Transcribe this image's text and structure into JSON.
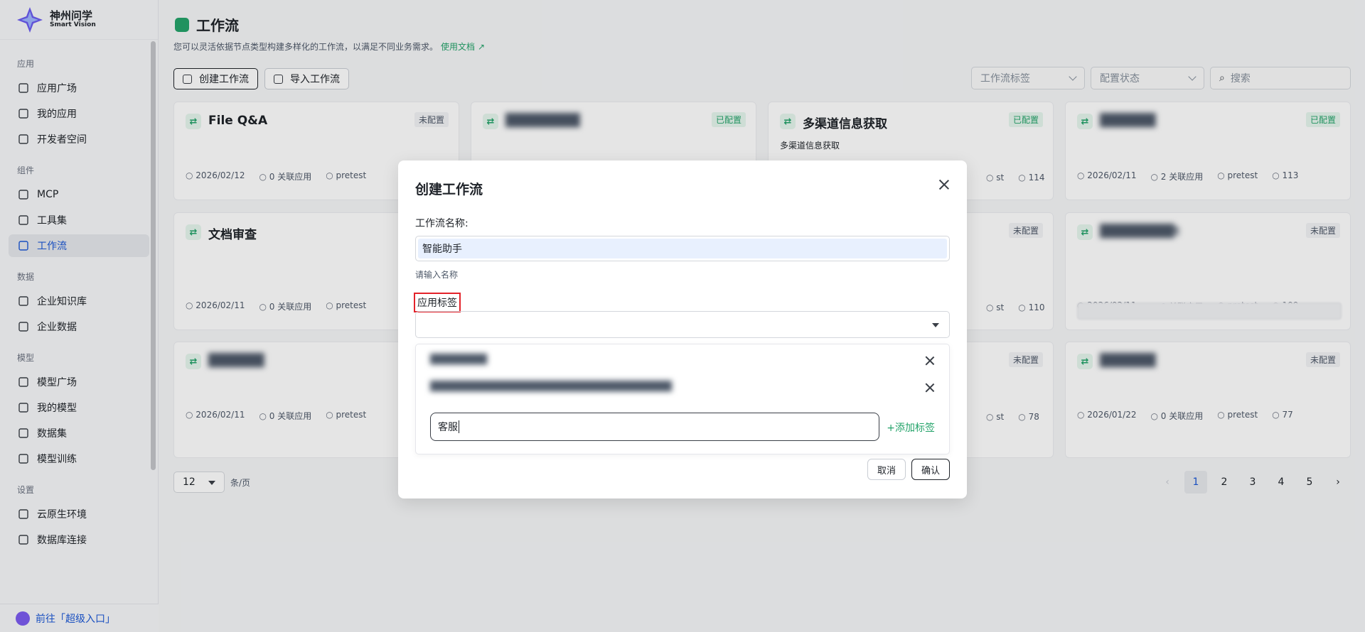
{
  "brand": {
    "name_cn": "神州问学",
    "name_en": "Smart Vision"
  },
  "sidebar": {
    "groups": [
      {
        "label": "应用",
        "items": [
          {
            "label": "应用广场",
            "icon": "store-icon"
          },
          {
            "label": "我的应用",
            "icon": "grid-icon"
          },
          {
            "label": "开发者空间",
            "icon": "cube-icon"
          }
        ]
      },
      {
        "label": "组件",
        "items": [
          {
            "label": "MCP",
            "icon": "mcp-icon"
          },
          {
            "label": "工具集",
            "icon": "toolbox-icon"
          },
          {
            "label": "工作流",
            "icon": "workflow-icon",
            "active": true
          }
        ]
      },
      {
        "label": "数据",
        "items": [
          {
            "label": "企业知识库",
            "icon": "book-icon"
          },
          {
            "label": "企业数据",
            "icon": "bar-chart-icon"
          }
        ]
      },
      {
        "label": "模型",
        "items": [
          {
            "label": "模型广场",
            "icon": "scan-icon"
          },
          {
            "label": "我的模型",
            "icon": "box-icon"
          },
          {
            "label": "数据集",
            "icon": "database-icon"
          },
          {
            "label": "模型训练",
            "icon": "training-icon"
          }
        ]
      },
      {
        "label": "设置",
        "items": [
          {
            "label": "云原生环境",
            "icon": "cloud-icon"
          },
          {
            "label": "数据库连接",
            "icon": "db-link-icon"
          }
        ]
      }
    ],
    "bottom_link": "前往「超级入口」"
  },
  "page": {
    "title": "工作流",
    "description": "您可以灵活依据节点类型构建多样化的工作流，以满足不同业务需求。",
    "doc_link": "使用文档",
    "create_button": "创建工作流",
    "import_button": "导入工作流",
    "filter_tag_placeholder": "工作流标签",
    "filter_status_placeholder": "配置状态",
    "search_placeholder": "搜索"
  },
  "cards": [
    {
      "title": "File Q&A",
      "status": "未配置",
      "desc": "",
      "date": "2026/02/12",
      "apps": "0 关联应用",
      "owner": "pretest",
      "id": ""
    },
    {
      "title": "████████",
      "status": "已配置",
      "desc": "",
      "date": "",
      "apps": "",
      "owner": "",
      "id": ""
    },
    {
      "title": "多渠道信息获取",
      "status": "已配置",
      "desc": "多渠道信息获取",
      "date": "",
      "apps": "",
      "owner": "st",
      "id": "114"
    },
    {
      "title": "██████",
      "status": "已配置",
      "desc": "",
      "date": "2026/02/11",
      "apps": "2 关联应用",
      "owner": "pretest",
      "id": "113"
    },
    {
      "title": "文档审查",
      "status": "",
      "desc": "",
      "date": "2026/02/11",
      "apps": "0 关联应用",
      "owner": "pretest",
      "id": ""
    },
    {
      "title": "",
      "status": "未配置",
      "desc": "",
      "date": "",
      "apps": "",
      "owner": "st",
      "id": "110"
    },
    {
      "title": "████████t",
      "status": "未配置",
      "desc": "",
      "date": "2026/02/11",
      "apps": "0 关联应用",
      "owner": "pretest",
      "id": "109"
    },
    {
      "title": "██████",
      "status": "",
      "desc": "",
      "date": "2026/02/11",
      "apps": "0 关联应用",
      "owner": "pretest",
      "id": ""
    },
    {
      "title": "",
      "status": "未配置",
      "desc": "",
      "date": "",
      "apps": "",
      "owner": "st",
      "id": "78"
    },
    {
      "title": "██████",
      "status": "未配置",
      "desc": "",
      "date": "2026/01/22",
      "apps": "0 关联应用",
      "owner": "pretest",
      "id": "77"
    }
  ],
  "pagination": {
    "page_size": "12",
    "unit": "条/页",
    "pages": [
      "1",
      "2",
      "3",
      "4",
      "5"
    ],
    "current": "1"
  },
  "modal": {
    "title": "创建工作流",
    "name_label": "工作流名称:",
    "name_value": "智能助手",
    "name_hint": "请输入名称",
    "tag_label": "应用标签",
    "tag_options": [
      "████████",
      "██████████████████████████████████"
    ],
    "new_tag_value": "客服",
    "add_tag_label": "+添加标签",
    "cancel": "取消",
    "confirm": "确认"
  }
}
